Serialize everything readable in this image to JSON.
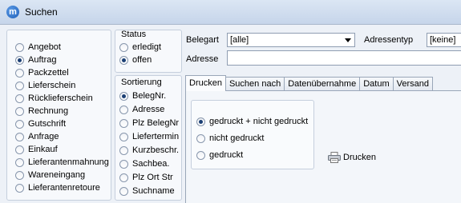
{
  "window": {
    "title": "Suchen",
    "icon": "app-logo-icon"
  },
  "doctypes": {
    "items": [
      "Angebot",
      "Auftrag",
      "Packzettel",
      "Lieferschein",
      "Rücklieferschein",
      "Rechnung",
      "Gutschrift",
      "Anfrage",
      "Einkauf",
      "Lieferantenmahnung",
      "Wareneingang",
      "Lieferantenretoure"
    ],
    "selected": "Auftrag"
  },
  "status": {
    "title": "Status",
    "options": [
      "erledigt",
      "offen"
    ],
    "selected": "offen"
  },
  "sort": {
    "title": "Sortierung",
    "options": [
      "BelegNr.",
      "Adresse",
      "Plz BelegNr",
      "Liefertermin",
      "Kurzbeschr.",
      "Sachbea.",
      "Plz Ort Str",
      "Suchname"
    ],
    "selected": "BelegNr."
  },
  "form": {
    "belegart_label": "Belegart",
    "belegart_value": "[alle]",
    "adressentyp_label": "Adressentyp",
    "adressentyp_value": "[keine]",
    "adresse_label": "Adresse",
    "adresse_value": ""
  },
  "tabs": {
    "items": [
      "Drucken",
      "Suchen nach",
      "Datenübernahme",
      "Datum",
      "Versand"
    ],
    "active": "Drucken"
  },
  "print": {
    "options": [
      "gedruckt + nicht gedruckt",
      "nicht gedruckt",
      "gedruckt"
    ],
    "selected": "gedruckt + nicht gedruckt",
    "button_label": "Drucken",
    "button_icon": "printer-icon"
  }
}
